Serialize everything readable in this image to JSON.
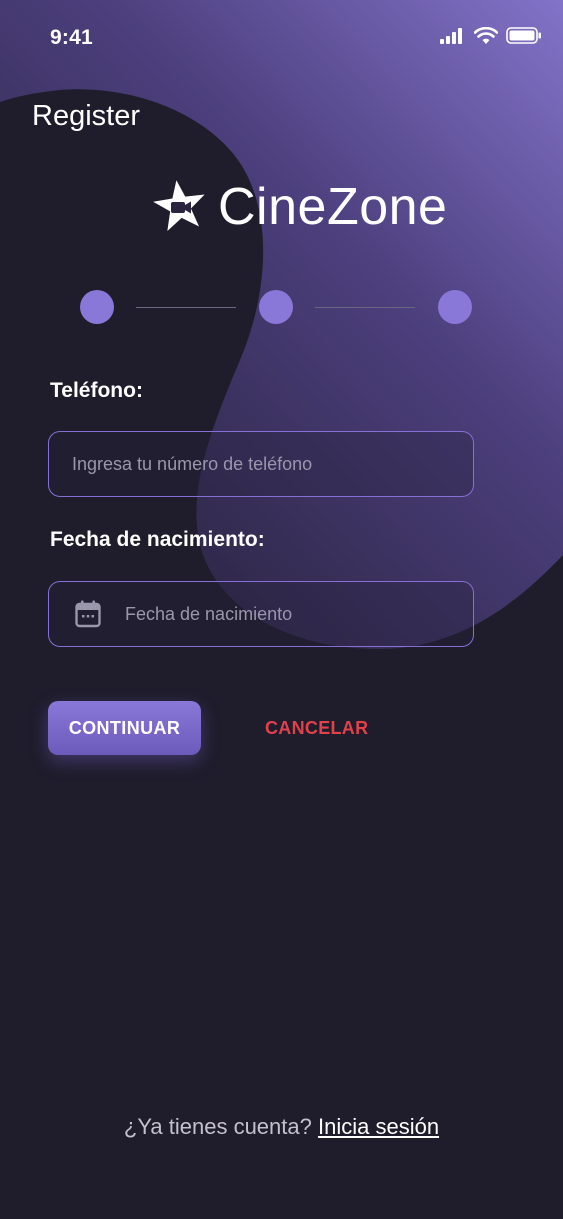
{
  "status_bar": {
    "time": "9:41",
    "icons": [
      "signal-icon",
      "wifi-icon",
      "battery-icon"
    ]
  },
  "header": {
    "title": "Register"
  },
  "brand": {
    "name": "CineZone",
    "logo_icon": "star-camera-icon"
  },
  "stepper": {
    "steps": 3,
    "current_step": 1
  },
  "form": {
    "phone": {
      "label": "Teléfono:",
      "placeholder": "Ingresa tu número de teléfono",
      "value": ""
    },
    "birthdate": {
      "label": "Fecha de nacimiento:",
      "placeholder": "Fecha de nacimiento",
      "value": "",
      "icon": "calendar-icon"
    }
  },
  "actions": {
    "continue_label": "CONTINUAR",
    "cancel_label": "CANCELAR"
  },
  "footer": {
    "prompt": "¿Ya tienes cuenta?",
    "link_label": "Inicia sesión"
  },
  "colors": {
    "background": "#1f1c2c",
    "accent": "#8a78d9",
    "danger": "#e0414a",
    "text": "#ffffff"
  }
}
